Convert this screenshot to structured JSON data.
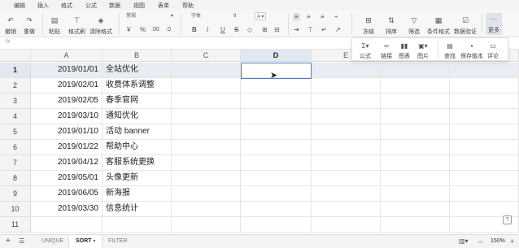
{
  "menu": [
    "编辑",
    "插入",
    "格式",
    "公式",
    "数据",
    "视图",
    "表单",
    "帮助"
  ],
  "toolbar": {
    "undo": "撤销",
    "redo": "重做",
    "paste": "粘贴",
    "format_painter": "格式刷",
    "clear_format": "清除格式",
    "number_format": "常规",
    "currency": "¥",
    "percent": "%",
    "dec_inc": ".00",
    "dec_dec": ".0",
    "font_name": "字体",
    "font_size": "9",
    "bold": "B",
    "italic": "I",
    "underline": "U",
    "strike": "S",
    "freeze": "冻结",
    "sort": "排序",
    "filter": "筛选",
    "cond_format": "条件格式",
    "validation": "数据验证",
    "more": "更多"
  },
  "more_panel": {
    "formula": "公式",
    "link": "链接",
    "chart": "图表",
    "image": "图片",
    "find": "查找",
    "save_version": "保存版本",
    "comment": "评论"
  },
  "formula_bar": {
    "fx": "fx",
    "value": ""
  },
  "columns": [
    "A",
    "B",
    "C",
    "D",
    "E"
  ],
  "selected_column": "D",
  "rows": [
    {
      "n": "1",
      "a": "2019/01/01",
      "b": "全站优化"
    },
    {
      "n": "2",
      "a": "2019/02/01",
      "b": "收费体系调整"
    },
    {
      "n": "3",
      "a": "2019/02/05",
      "b": "春季官网"
    },
    {
      "n": "4",
      "a": "2019/03/10",
      "b": "通知优化"
    },
    {
      "n": "5",
      "a": "2019/01/10",
      "b": "活动 banner"
    },
    {
      "n": "6",
      "a": "2019/01/22",
      "b": "帮助中心"
    },
    {
      "n": "7",
      "a": "2019/04/12",
      "b": "客服系统更换"
    },
    {
      "n": "8",
      "a": "2019/05/01",
      "b": "头像更新"
    },
    {
      "n": "9",
      "a": "2019/06/05",
      "b": "新海报"
    },
    {
      "n": "10",
      "a": "2019/03/30",
      "b": "信息统计"
    },
    {
      "n": "11",
      "a": "",
      "b": ""
    }
  ],
  "sheets": [
    "UNIQUE",
    "SORT",
    "FILTER"
  ],
  "active_sheet": "SORT",
  "zoom": "150%",
  "colors": {
    "accent": "#4a7bd0",
    "header_bg": "#f4f4f4",
    "active_header": "#e3e8f0"
  }
}
